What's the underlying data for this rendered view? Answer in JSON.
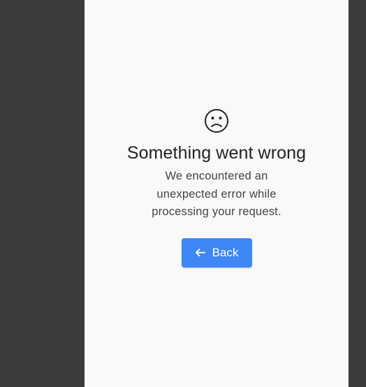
{
  "error_page": {
    "icon": "sad-face-icon",
    "title": "Something went wrong",
    "message": "We encountered an unexpected error while processing your request.",
    "back_button": {
      "label": "Back",
      "icon": "arrow-left-icon"
    }
  },
  "colors": {
    "accent": "#3f87f5",
    "background": "#3b3b3b",
    "panel": "#f9f9f9",
    "text": "#222222"
  }
}
